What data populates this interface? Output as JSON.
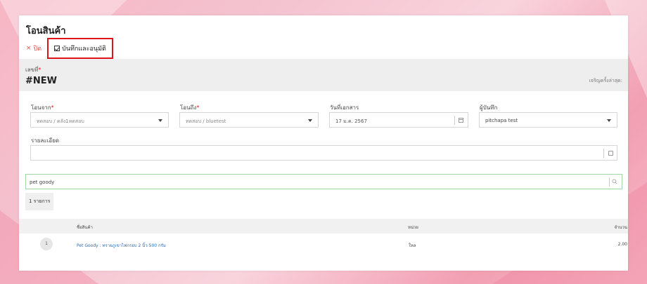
{
  "page": {
    "title": "โอนสินค้า",
    "toolbar": {
      "close_label": "ปิด",
      "close_icon": "×",
      "save_approve_label": "บันทึกและอนุมัติ"
    },
    "document": {
      "number_label": "เลขที่",
      "required_mark": "*",
      "number_value": "#NEW",
      "side_note": "เจริญครั้งล่าสุด:"
    },
    "fields": {
      "from_label": "โอนจาก",
      "from_value": "ทดสอบ / คลัง1ทดสอบ",
      "to_label": "โอนถึง",
      "to_value": "ทดสอบ / bluetest",
      "date_label": "วันที่เอกสาร",
      "date_value": "17 ม.ค. 2567",
      "recorder_label": "ผู้บันทึก",
      "recorder_value": "pitchapa test",
      "description_label": "รายละเอียด",
      "description_value": ""
    },
    "search": {
      "value": "pet goody"
    },
    "items_count_label": "1 รายการ",
    "table": {
      "headers": {
        "product": "ชื่อสินค้า",
        "unit": "หน่วย",
        "quantity": "จำนวน"
      },
      "rows": [
        {
          "index": "1",
          "product": "Pet Goody : ทรายภูเขาไฟกรอบ 2 นิ้ว 500 กรัม",
          "unit": "ใหล",
          "quantity": "2.00"
        }
      ]
    }
  },
  "colors": {
    "close_red": "#d9534f",
    "highlight_red": "#e0151b",
    "link_blue": "#2b6cb0",
    "search_border_green": "#9fd6a5"
  }
}
